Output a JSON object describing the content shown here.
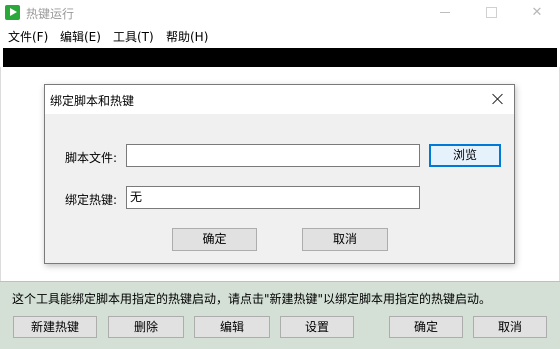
{
  "window": {
    "title": "热键运行",
    "min_icon": "minimize-icon",
    "max_icon": "maximize-icon",
    "close_icon": "close-icon"
  },
  "menu": [
    "文件(F)",
    "编辑(E)",
    "工具(T)",
    "帮助(H)"
  ],
  "bottom": {
    "hint": "这个工具能绑定脚本用指定的热键启动，请点击\"新建热键\"以绑定脚本用指定的热键启动。",
    "buttons": [
      "新建热键",
      "删除",
      "编辑",
      "设置",
      "确定",
      "取消"
    ]
  },
  "dialog": {
    "title": "绑定脚本和热键",
    "script_label": "脚本文件:",
    "script_value": "",
    "browse_label": "浏览",
    "hotkey_label": "绑定热键:",
    "hotkey_value": "无",
    "ok_label": "确定",
    "cancel_label": "取消"
  },
  "colors": {
    "bottom_panel": "#d4dfd6",
    "focus_accent": "#0078d7",
    "app_icon": "#2aa83a"
  }
}
